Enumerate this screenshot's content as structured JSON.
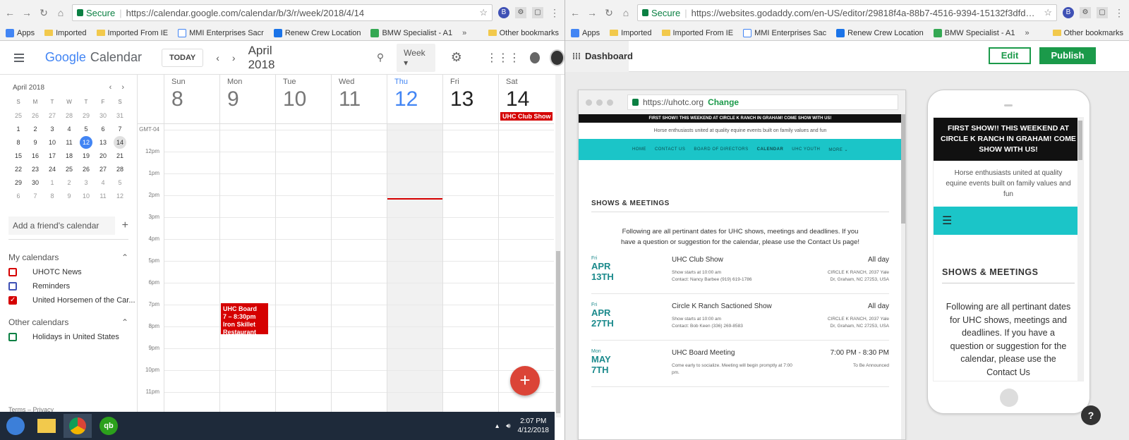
{
  "left_browser": {
    "secure_label": "Secure",
    "url": "https://calendar.google.com/calendar/b/3/r/week/2018/4/14",
    "bookmarks": [
      "Apps",
      "Imported",
      "Imported From IE",
      "MMI Enterprises Sacr",
      "Renew Crew Location",
      "BMW Specialist - A1"
    ],
    "more_label": "»",
    "other_bookmarks": "Other bookmarks"
  },
  "calendar": {
    "app_name_1": "Google",
    "app_name_2": "Calendar",
    "today_label": "TODAY",
    "month_title": "April 2018",
    "view_label": "Week",
    "mini": {
      "title": "April 2018",
      "dows": [
        "S",
        "M",
        "T",
        "W",
        "T",
        "F",
        "S"
      ],
      "weeks": [
        [
          "25",
          "26",
          "27",
          "28",
          "29",
          "30",
          "31"
        ],
        [
          "1",
          "2",
          "3",
          "4",
          "5",
          "6",
          "7"
        ],
        [
          "8",
          "9",
          "10",
          "11",
          "12",
          "13",
          "14"
        ],
        [
          "15",
          "16",
          "17",
          "18",
          "19",
          "20",
          "21"
        ],
        [
          "22",
          "23",
          "24",
          "25",
          "26",
          "27",
          "28"
        ],
        [
          "29",
          "30",
          "1",
          "2",
          "3",
          "4",
          "5"
        ],
        [
          "6",
          "7",
          "8",
          "9",
          "10",
          "11",
          "12"
        ]
      ]
    },
    "add_friend": "Add a friend's calendar",
    "my_calendars_label": "My calendars",
    "my_calendars": [
      {
        "name": "UHOTC News",
        "color": "#d50000",
        "checked": false
      },
      {
        "name": "Reminders",
        "color": "#3f51b5",
        "checked": false
      },
      {
        "name": "United Horsemen of the Car...",
        "color": "#d50000",
        "checked": true
      }
    ],
    "other_calendars_label": "Other calendars",
    "other_calendars": [
      {
        "name": "Holidays in United States",
        "color": "#0b8043",
        "checked": false
      }
    ],
    "footer": "Terms – Privacy",
    "timezone": "GMT-04",
    "days": [
      {
        "name": "Sun",
        "date": "8"
      },
      {
        "name": "Mon",
        "date": "9"
      },
      {
        "name": "Tue",
        "date": "10"
      },
      {
        "name": "Wed",
        "date": "11"
      },
      {
        "name": "Thu",
        "date": "12"
      },
      {
        "name": "Fri",
        "date": "13"
      },
      {
        "name": "Sat",
        "date": "14"
      }
    ],
    "hours": [
      "12pm",
      "1pm",
      "2pm",
      "3pm",
      "4pm",
      "5pm",
      "6pm",
      "7pm",
      "8pm",
      "9pm",
      "10pm",
      "11pm"
    ],
    "allday_event": "UHC Club Show",
    "event": {
      "title": "UHC Board",
      "time": "7 – 8:30pm",
      "place_1": "Iron Skillet",
      "place_2": "Restaurant"
    },
    "fab": "+"
  },
  "taskbar": {
    "qb_label": "qb",
    "time": "2:07 PM",
    "date": "4/12/2018"
  },
  "right_browser": {
    "secure_label": "Secure",
    "url": "https://websites.godaddy.com/en-US/editor/29818f4a-88b7-4516-9394-15132f3dfdd2/95aa352c-fb69-4...",
    "bookmarks": [
      "Apps",
      "Imported",
      "Imported From IE",
      "MMI Enterprises Sac",
      "Renew Crew Location",
      "BMW Specialist - A1"
    ],
    "more_label": "»",
    "other_bookmarks": "Other bookmarks"
  },
  "godaddy": {
    "dashboard": "Dashboard",
    "edit": "Edit",
    "publish": "Publish",
    "preview_url": "https://uhotc.org",
    "change": "Change",
    "banner": "FIRST SHOW!! THIS WEEKEND AT CIRCLE K RANCH IN GRAHAM! COME SHOW WITH US!",
    "tagline": "Horse enthusiasts united at quality equine events built on family values and fun",
    "nav": [
      "HOME",
      "CONTACT US",
      "BOARD OF DIRECTORS",
      "CALENDAR",
      "UHC YOUTH",
      "MORE ⌄"
    ],
    "section_title": "SHOWS & MEETINGS",
    "intro": "Following are all pertinant dates for UHC shows,  meetings and deadlines. If you have a question or suggestion for the calendar, please use the Contact Us page!",
    "events": [
      {
        "weekday": "Fri",
        "month": "APR",
        "day": "13TH",
        "title": "UHC Club Show",
        "detail_1": "Show starts at 10:00 am",
        "detail_2": "Contact: Nancy Barbee (919) 619-1786",
        "time": "All day",
        "loc_1": "CIRCLE K RANCH, 2037 Yale",
        "loc_2": "Dr, Graham, NC 27253, USA"
      },
      {
        "weekday": "Fri",
        "month": "APR",
        "day": "27TH",
        "title": "Circle K Ranch Sactioned Show",
        "detail_1": "Show starts at 10:00 am",
        "detail_2": "Contact: Bob Keen (336) 269-8583",
        "time": "All day",
        "loc_1": "CIRCLE K RANCH, 2037 Yale",
        "loc_2": "Dr, Graham, NC 27253, USA"
      },
      {
        "weekday": "Mon",
        "month": "MAY",
        "day": "7TH",
        "title": "UHC Board Meeting",
        "detail_1": "Come early to socialize. Meeting will begin promptly at 7:00",
        "detail_2": "pm.",
        "time": "7:00 PM - 8:30 PM",
        "loc_1": "To Be Announced",
        "loc_2": ""
      }
    ],
    "mobile_banner": "FIRST SHOW!! THIS WEEKEND AT CIRCLE K RANCH IN GRAHAM! COME SHOW WITH US!",
    "mobile_tagline": "Horse enthusiasts united at quality equine events built on family values and fun",
    "mobile_section_title": "SHOWS & MEETINGS",
    "mobile_intro": "Following are all pertinant dates for UHC shows, meetings and deadlines. If you have a question or suggestion for the calendar, please use the Contact Us",
    "help": "?"
  }
}
